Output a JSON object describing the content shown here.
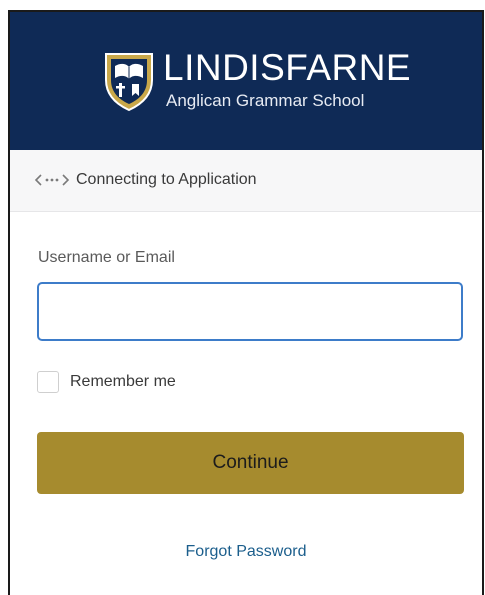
{
  "header": {
    "brand_name": "LINDISFARNE",
    "brand_subtitle": "Anglican Grammar School",
    "crest_icon": "school-crest-icon"
  },
  "connect": {
    "icon": "connect-arrows-icon",
    "text": "Connecting to Application"
  },
  "form": {
    "username_label": "Username or Email",
    "username_value": "",
    "username_placeholder": "",
    "remember_label": "Remember me",
    "remember_checked": false,
    "continue_label": "Continue",
    "forgot_label": "Forgot Password"
  },
  "colors": {
    "header_bg": "#0f2a56",
    "button_bg": "#a68b2e",
    "link": "#1b5e8c",
    "input_focus_border": "#3d7cc9"
  }
}
